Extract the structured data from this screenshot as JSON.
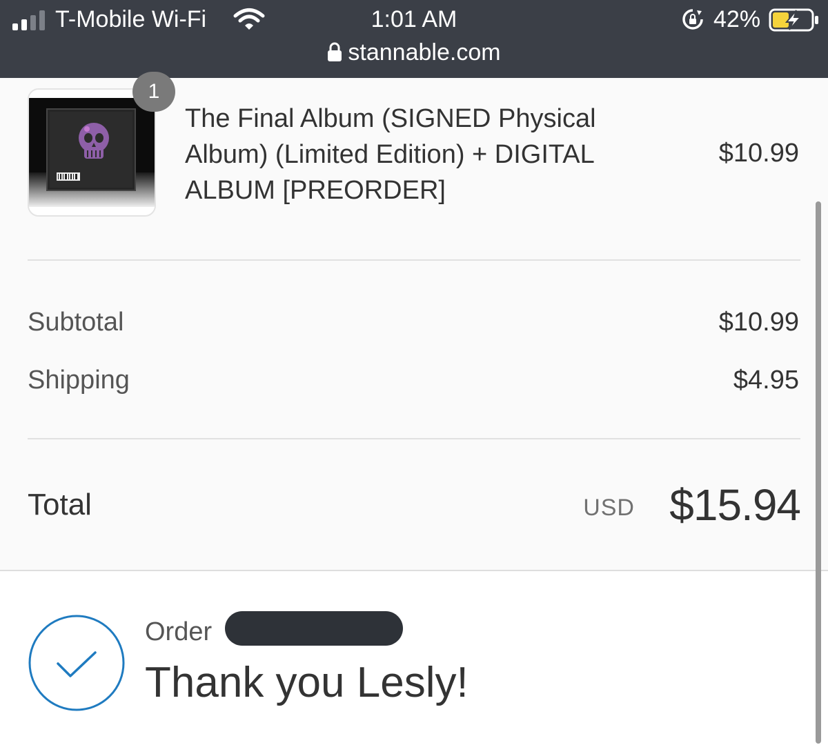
{
  "status_bar": {
    "carrier": "T-Mobile Wi-Fi",
    "time": "1:01 AM",
    "battery_percent": "42%",
    "battery_level": 0.42,
    "signal_bars_active": 2,
    "icons": [
      "signal-bars-icon",
      "wifi-icon",
      "rotation-lock-icon",
      "battery-charging-icon"
    ]
  },
  "url_bar": {
    "domain": "stannable.com",
    "secure_icon": "lock-icon"
  },
  "cart": {
    "items": [
      {
        "quantity": "1",
        "title": "The Final Album (SIGNED Physical Album) (Limited Edition) + DIGITAL ALBUM [PREORDER]",
        "price": "$10.99",
        "thumbnail": "album-cover-skull"
      }
    ]
  },
  "summary": {
    "subtotal_label": "Subtotal",
    "subtotal_value": "$10.99",
    "shipping_label": "Shipping",
    "shipping_value": "$4.95",
    "total_label": "Total",
    "total_currency": "USD",
    "total_value": "$15.94"
  },
  "confirmation": {
    "order_label": "Order",
    "order_number_redacted": true,
    "thank_you": "Thank you Lesly!",
    "icon": "check-circle-icon"
  },
  "colors": {
    "topbar_bg": "#3b3f47",
    "summary_bg": "#fafafa",
    "accent_blue": "#1f7bc0",
    "battery_yellow": "#f5d33b",
    "text_dark": "#333333"
  }
}
